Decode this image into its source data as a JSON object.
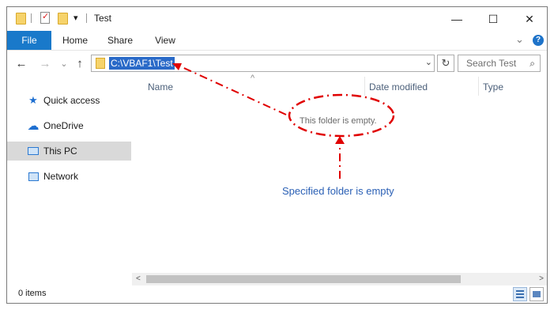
{
  "window": {
    "title": "Test",
    "controls": {
      "minimize": "—",
      "maximize": "☐",
      "close": "✕"
    }
  },
  "quick_access_toolbar": {
    "dropdown_glyph": "▾"
  },
  "ribbon": {
    "tabs": [
      {
        "label": "File"
      },
      {
        "label": "Home"
      },
      {
        "label": "Share"
      },
      {
        "label": "View"
      }
    ],
    "expand_glyph": "⌄",
    "help_glyph": "?"
  },
  "navigation": {
    "back_glyph": "←",
    "forward_glyph": "→",
    "recent_glyph": "⌄",
    "up_glyph": "↑",
    "address_path": "C:\\VBAF1\\Test",
    "address_dropdown_glyph": "⌄",
    "refresh_glyph": "↻",
    "search_placeholder": "Search Test",
    "search_glyph": "⌕"
  },
  "sidebar": {
    "items": [
      {
        "label": "Quick access",
        "icon": "star-icon",
        "glyph": "★",
        "color": "#1e6fd0"
      },
      {
        "label": "OneDrive",
        "icon": "cloud-icon",
        "glyph": "☁",
        "color": "#1e6fd0"
      },
      {
        "label": "This PC",
        "icon": "computer-icon",
        "glyph": "🖥",
        "color": "#2b79d1",
        "selected": true
      },
      {
        "label": "Network",
        "icon": "network-icon",
        "glyph": "🖧",
        "color": "#2b79d1"
      }
    ]
  },
  "file_list": {
    "sort_glyph": "^",
    "columns": [
      {
        "label": "Name"
      },
      {
        "label": "Date modified"
      },
      {
        "label": "Type"
      }
    ],
    "empty_message": "This folder is empty."
  },
  "status_bar": {
    "item_count": "0 items"
  },
  "annotation": {
    "text": "Specified folder is empty",
    "color": "#e00000",
    "text_color": "#2b60b5"
  },
  "colors": {
    "file_tab": "#1979ca",
    "selection": "#2a6ac8",
    "folder": "#f6d36b",
    "sidebar_selected": "#d9d9d9"
  }
}
